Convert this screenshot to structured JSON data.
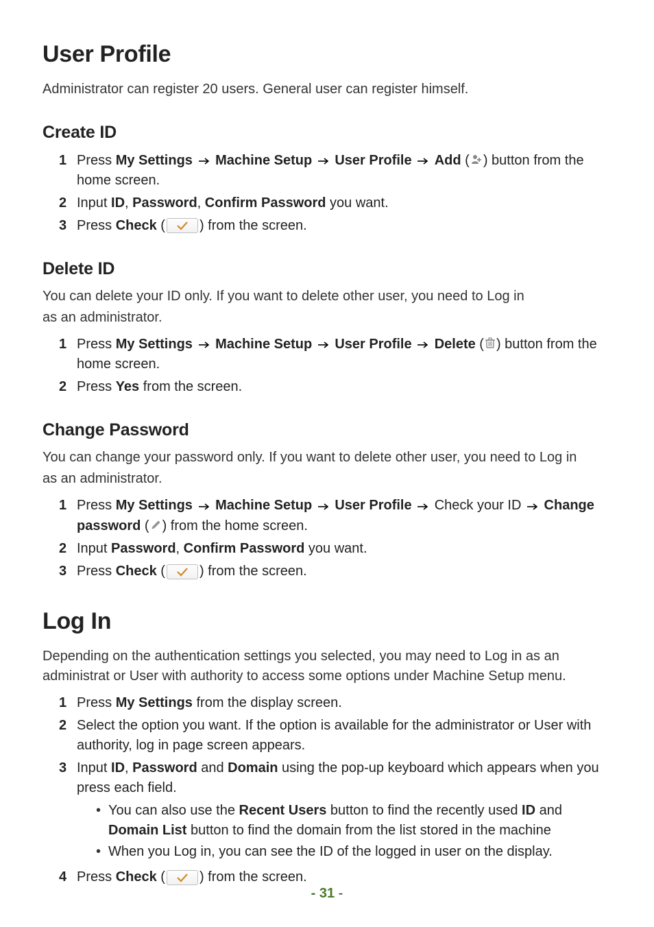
{
  "h1_user_profile": "User Profile",
  "intro_user_profile": "Administrator can register 20 users. General user can register himself.",
  "h2_create_id": "Create ID",
  "create_id": {
    "s1_a": "Press ",
    "s1_b": "My Settings",
    "s1_c": "Machine Setup",
    "s1_d": "User Profile",
    "s1_e": "Add",
    "s1_f": " (",
    "s1_g": ") button from the home screen.",
    "s2_a": "Input ",
    "s2_b": "ID",
    "s2_c": ", ",
    "s2_d": "Password",
    "s2_e": ", ",
    "s2_f": "Confirm Password",
    "s2_g": " you want.",
    "s3_a": "Press ",
    "s3_b": "Check",
    "s3_c": " (",
    "s3_d": ") from the screen."
  },
  "h2_delete_id": "Delete ID",
  "delete_intro_1": "You can delete your ID only. If you want to delete other user, you need to Log in",
  "delete_intro_2": "as an administrator.",
  "delete_id": {
    "s1_a": "Press ",
    "s1_b": "My Settings",
    "s1_c": "Machine Setup",
    "s1_d": "User Profile",
    "s1_e": "Delete",
    "s1_f": " (",
    "s1_g": ") button from the home screen.",
    "s2_a": "Press ",
    "s2_b": "Yes",
    "s2_c": " from the screen."
  },
  "h2_change_pw": "Change Password",
  "change_intro_1": "You can change your password only. If you want to delete other user, you need to Log in",
  "change_intro_2": "as an administrator.",
  "change_pw": {
    "s1_a": "Press ",
    "s1_b": "My Settings",
    "s1_c": "Machine Setup",
    "s1_d": "User Profile",
    "s1_e": " Check your ID ",
    "s1_f": "Change password",
    "s1_g": " (",
    "s1_h": ") from the home screen.",
    "s2_a": "Input ",
    "s2_b": "Password",
    "s2_c": ", ",
    "s2_d": "Confirm Password",
    "s2_e": " you want.",
    "s3_a": "Press ",
    "s3_b": "Check",
    "s3_c": " (",
    "s3_d": ") from the screen."
  },
  "h1_login": "Log In",
  "login_intro": "Depending on the authentication settings you selected, you may need to Log in as an administrat or User with authority to access some options under Machine Setup menu.",
  "login": {
    "s1_a": "Press ",
    "s1_b": "My Settings",
    "s1_c": " from the display screen.",
    "s2": "Select the option you want. If the option is available for the administrator or User with authority, log in page screen appears.",
    "s3_a": "Input ",
    "s3_b": "ID",
    "s3_c": ", ",
    "s3_d": "Password",
    "s3_e": " and ",
    "s3_f": "Domain",
    "s3_g": " using the pop-up keyboard which appears when you press each field.",
    "s3_sub1_a": "You can also use the ",
    "s3_sub1_b": "Recent Users",
    "s3_sub1_c": " button to find the recently used ",
    "s3_sub1_d": "ID",
    "s3_sub1_e": " and ",
    "s3_sub1_f": "Domain List",
    "s3_sub1_g": " button to find the domain from the list stored in the machine",
    "s3_sub2": "When you Log in, you can see the ID of the logged in user on the display.",
    "s4_a": "Press ",
    "s4_b": "Check",
    "s4_c": " (",
    "s4_d": ") from the screen."
  },
  "page_number": "- 31",
  "page_dash": " -",
  "nums": {
    "n1": "1",
    "n2": "2",
    "n3": "3",
    "n4": "4"
  }
}
